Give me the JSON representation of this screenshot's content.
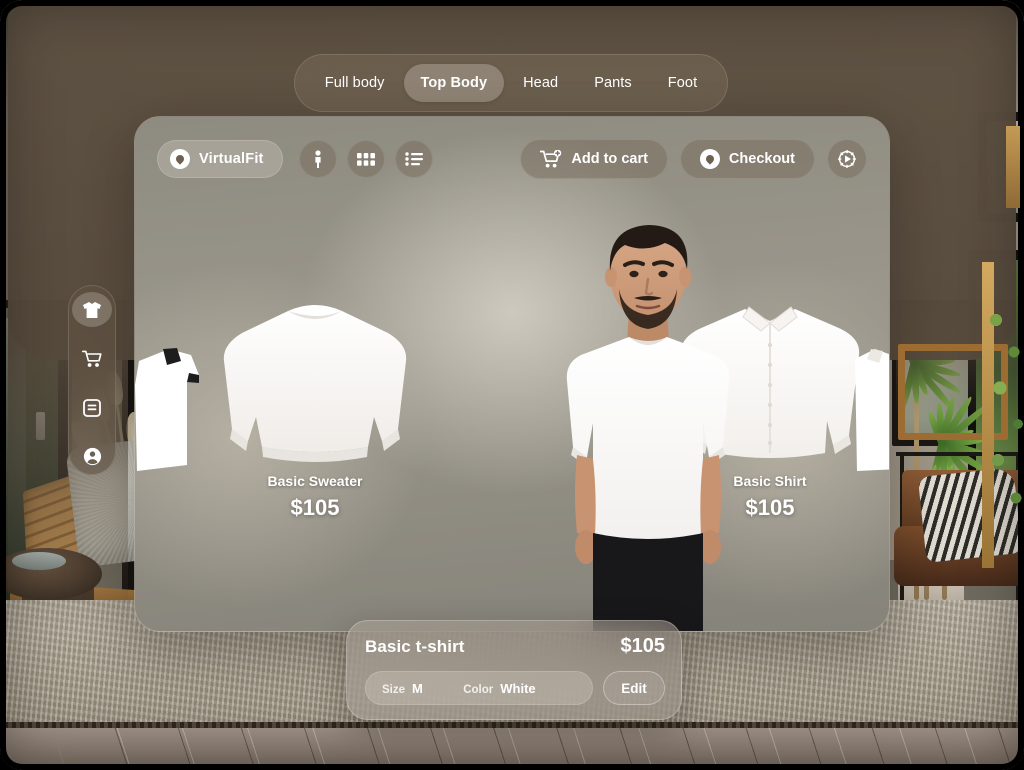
{
  "app": {
    "name": "VirtualFit",
    "logo_icon": "circle-logo-icon"
  },
  "tabbar": {
    "tabs": [
      {
        "label": "Full body",
        "active": false
      },
      {
        "label": "Top Body",
        "active": true
      },
      {
        "label": "Head",
        "active": false
      },
      {
        "label": "Pants",
        "active": false
      },
      {
        "label": "Foot",
        "active": false
      }
    ]
  },
  "toolbar": {
    "brand_label": "VirtualFit",
    "view_buttons": [
      {
        "name": "avatar-view",
        "icon": "person-icon"
      },
      {
        "name": "grid-view",
        "icon": "grid-icon"
      },
      {
        "name": "list-view",
        "icon": "list-icon"
      }
    ],
    "add_to_cart_label": "Add to cart",
    "add_to_cart_icon": "cart-plus-icon",
    "checkout_label": "Checkout",
    "checkout_icon": "circle-logo-icon",
    "settings_icon": "gear-icon"
  },
  "sidebar": {
    "items": [
      {
        "name": "sidebar-item-wardrobe",
        "icon": "tshirt-icon",
        "active": true
      },
      {
        "name": "sidebar-item-cart",
        "icon": "cart-icon",
        "active": false
      },
      {
        "name": "sidebar-item-orders",
        "icon": "document-icon",
        "active": false
      },
      {
        "name": "sidebar-item-account",
        "icon": "account-icon",
        "active": false
      }
    ]
  },
  "gallery": {
    "items": [
      {
        "name": "Basic Sweater",
        "price": "$105",
        "garment": "sweater"
      },
      {
        "name": "Basic Shirt",
        "price": "$105",
        "garment": "shirt"
      }
    ],
    "edge_left_garment": "white-polo-black-trim",
    "edge_right_garment": "white-polo"
  },
  "model": {
    "wearing": "white t-shirt",
    "description": "Man with dark hair and beard wearing a white t-shirt and black pants"
  },
  "product_card": {
    "title": "Basic t-shirt",
    "price": "$105",
    "size_label": "Size",
    "size_value": "M",
    "color_label": "Color",
    "color_value": "White",
    "edit_label": "Edit"
  },
  "colors": {
    "accent_warm": "#7e6f5c",
    "panel_glass": "#8e8b80",
    "text_on_glass": "#ffffff",
    "overlay_brown": "#574b3d"
  }
}
